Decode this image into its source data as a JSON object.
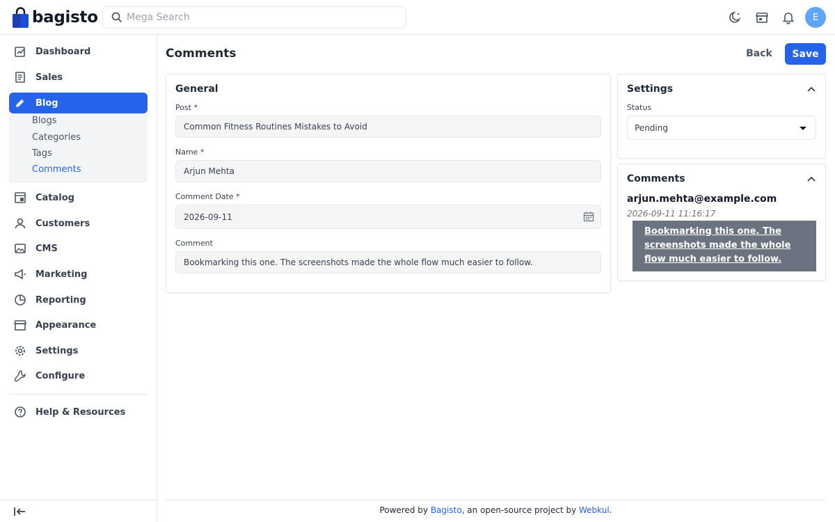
{
  "header": {
    "brand": "bagisto",
    "search": {
      "placeholder": "Mega Search",
      "value": ""
    },
    "avatar_initial": "E",
    "icons": [
      "moon-icon",
      "storefront-icon",
      "bell-icon"
    ]
  },
  "sidebar": {
    "items": [
      {
        "label": "Dashboard",
        "icon": "dashboard-icon"
      },
      {
        "label": "Sales",
        "icon": "receipt-icon"
      },
      {
        "label": "Blog",
        "icon": "pencil-icon",
        "active": true
      },
      {
        "label": "Catalog",
        "icon": "catalog-icon"
      },
      {
        "label": "Customers",
        "icon": "user-icon"
      },
      {
        "label": "CMS",
        "icon": "image-icon"
      },
      {
        "label": "Marketing",
        "icon": "megaphone-icon"
      },
      {
        "label": "Reporting",
        "icon": "pie-chart-icon"
      },
      {
        "label": "Appearance",
        "icon": "store-icon"
      },
      {
        "label": "Settings",
        "icon": "gear-icon"
      },
      {
        "label": "Configure",
        "icon": "wrench-icon"
      }
    ],
    "blog_submenu": [
      "Blogs",
      "Categories",
      "Tags",
      "Comments"
    ],
    "help": "Help & Resources"
  },
  "page": {
    "title": "Comments",
    "back_label": "Back",
    "save_label": "Save"
  },
  "general": {
    "title": "General",
    "post_label": "Post *",
    "post_value": "Common Fitness Routines Mistakes to Avoid",
    "name_label": "Name *",
    "name_value": "Arjun Mehta",
    "date_label": "Comment Date *",
    "date_value": "2026-09-11",
    "comment_label": "Comment",
    "comment_value": "Bookmarking this one. The screenshots made the whole flow much easier to follow."
  },
  "settings": {
    "title": "Settings",
    "status_label": "Status",
    "status_value": "Pending"
  },
  "comments_panel": {
    "title": "Comments",
    "email": "arjun.mehta@example.com",
    "timestamp": "2026-09-11 11:16:17",
    "text": "Bookmarking this one. The screenshots made the whole flow much easier to follow."
  },
  "footer": {
    "prefix": "Powered by ",
    "link1": "Bagisto",
    "middle": ", an open-source project by ",
    "link2": "Webkul",
    "suffix": "."
  },
  "colors": {
    "accent": "#2563eb",
    "bubble": "#6b7280"
  }
}
